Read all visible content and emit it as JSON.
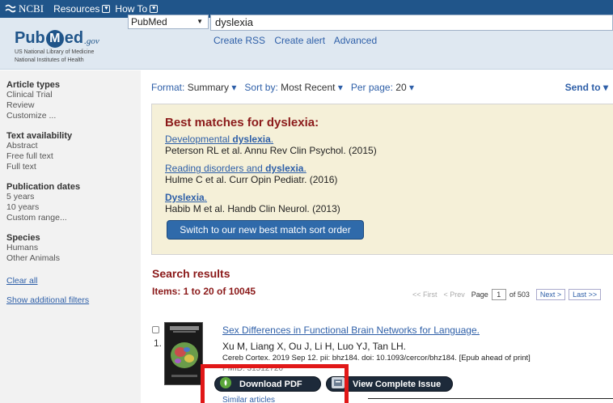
{
  "topbar": {
    "brand": "NCBI",
    "menus": [
      "Resources",
      "How To"
    ]
  },
  "header": {
    "logo_text_pub": "Pub",
    "logo_text_m": "M",
    "logo_text_ed": "ed",
    "logo_gov": ".gov",
    "logo_sub1": "US National Library of Medicine",
    "logo_sub2": "National Institutes of Health",
    "db_select": "PubMed",
    "search_value": "dyslexia",
    "links": [
      "Create RSS",
      "Create alert",
      "Advanced"
    ]
  },
  "sidebar": {
    "article_types": {
      "heading": "Article types",
      "items": [
        "Clinical Trial",
        "Review",
        "Customize ..."
      ]
    },
    "text_availability": {
      "heading": "Text availability",
      "items": [
        "Abstract",
        "Free full text",
        "Full text"
      ]
    },
    "publication_dates": {
      "heading": "Publication dates",
      "items": [
        "5 years",
        "10 years",
        "Custom range..."
      ]
    },
    "species": {
      "heading": "Species",
      "items": [
        "Humans",
        "Other Animals"
      ]
    },
    "clear_all": "Clear all",
    "show_filters": "Show additional filters"
  },
  "format_bar": {
    "format_label": "Format:",
    "format_value": "Summary",
    "sort_label": "Sort by:",
    "sort_value": "Most Recent",
    "per_page_label": "Per page:",
    "per_page_value": "20",
    "send_to": "Send to"
  },
  "best_matches": {
    "heading": "Best matches for dyslexia:",
    "items": [
      {
        "title_pre": "Developmental ",
        "title_bold": "dyslexia",
        "title_post": ".",
        "authors": "Peterson RL et al. Annu Rev Clin Psychol. (2015)"
      },
      {
        "title_pre": "Reading disorders and ",
        "title_bold": "dyslexia",
        "title_post": ".",
        "authors": "Hulme C et al. Curr Opin Pediatr. (2016)"
      },
      {
        "title_pre": "",
        "title_bold": "Dyslexia",
        "title_post": ".",
        "authors": "Habib M et al. Handb Clin Neurol. (2013)"
      }
    ],
    "switch_button": "Switch to our new best match sort order"
  },
  "results": {
    "heading": "Search results",
    "items_count": "Items: 1 to 20 of 10045",
    "pager": {
      "first": "<< First",
      "prev": "< Prev",
      "page_label": "Page",
      "page_value": "1",
      "of": "of 503",
      "next": "Next >",
      "last": "Last >>"
    },
    "first": {
      "number": "1.",
      "title": "Sex Differences in Functional Brain Networks for Language.",
      "authors": "Xu M, Liang X, Ou J, Li H, Luo YJ, Tan LH.",
      "citation": "Cereb Cortex. 2019 Sep 12. pii: bhz184. doi: 10.1093/cercor/bhz184. [Epub ahead of print]",
      "pmid": "PMID: 31512720",
      "download_pdf": "Download PDF",
      "view_issue": "View Complete Issue",
      "similar": "Similar articles"
    }
  },
  "colors": {
    "topbar": "#20558a",
    "link": "#2e5fa8",
    "heading_red": "#8b1a1a",
    "highlight_box": "#e11818"
  }
}
